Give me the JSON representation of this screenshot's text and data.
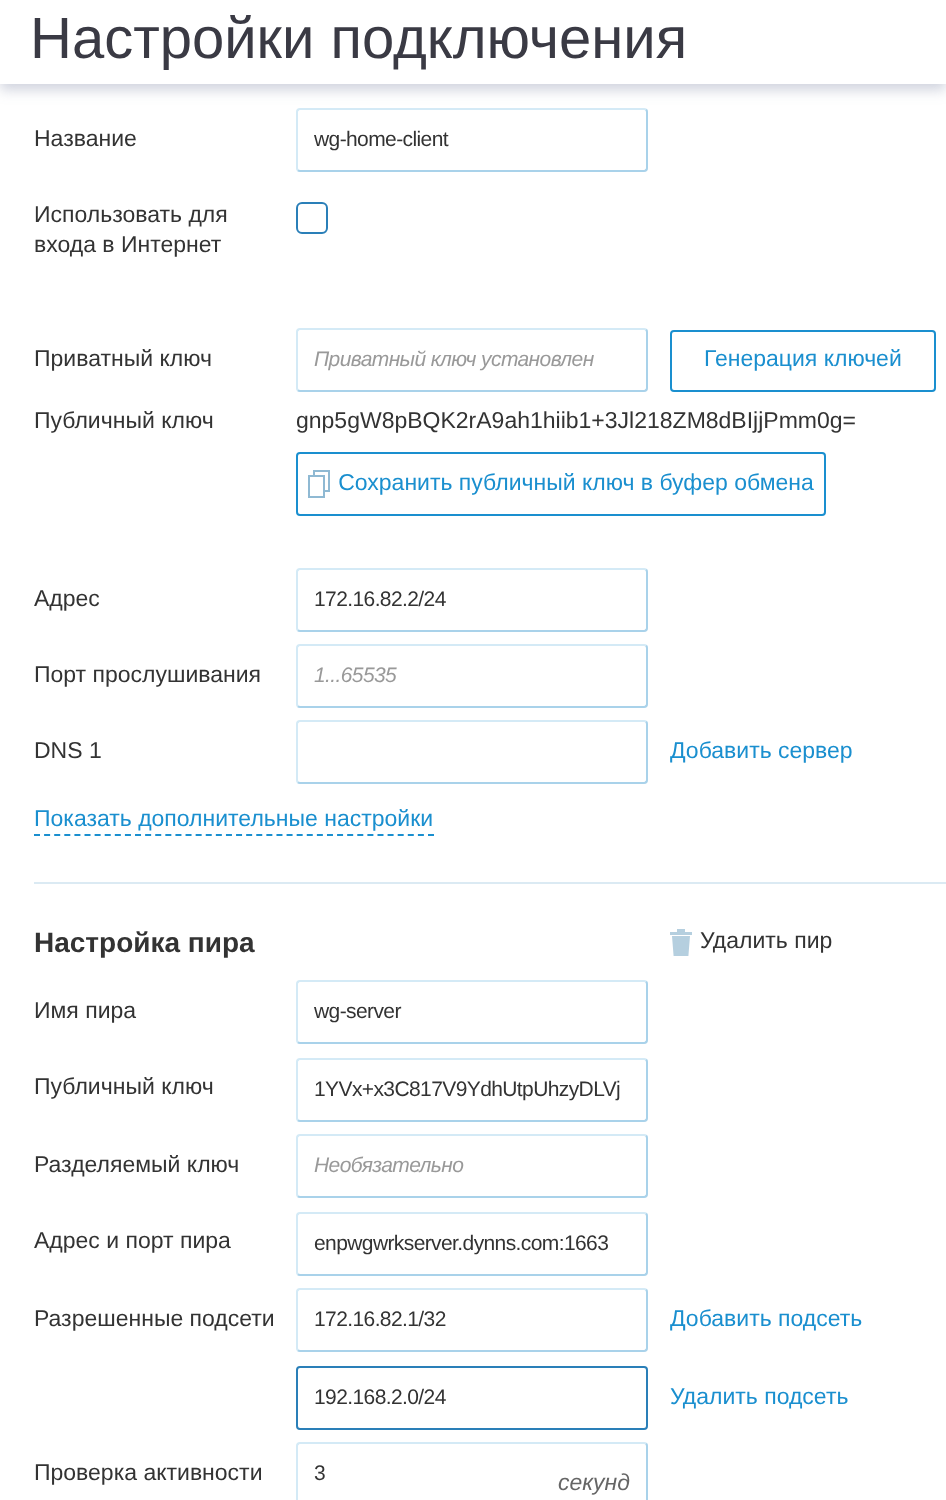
{
  "title": "Настройки подключения",
  "connection": {
    "groups": [
      [
        {
          "kind": "input",
          "label": "Название",
          "value": "wg-home-client",
          "focused": false
        },
        {
          "kind": "checkbox",
          "label": "Использовать для входа в Интернет",
          "checked": false
        }
      ],
      [
        {
          "kind": "input",
          "label": "Приватный ключ",
          "placeholder": "Приватный ключ установлен",
          "focused": false,
          "button": "Генерация ключей"
        },
        {
          "kind": "text",
          "label": "Публичный ключ",
          "value": "gnp5gW8pBQK2rA9ah1hiib1+3Jl218ZM8dBIjjPmm0g="
        },
        {
          "kind": "button",
          "label": "Сохранить публичный ключ в буфер обмена"
        }
      ],
      [
        {
          "kind": "input",
          "label": "Адрес",
          "value": "172.16.82.2/24",
          "focused": false
        },
        {
          "kind": "input",
          "label": "Порт прослушивания",
          "placeholder": "1...65535",
          "focused": false
        },
        {
          "kind": "input",
          "label": "DNS 1",
          "focused": false,
          "link": "Добавить сервер"
        }
      ]
    ],
    "advanced_link": "Показать дополнительные настройки"
  },
  "peer": {
    "title": "Настройка пира",
    "delete": "Удалить пир",
    "rows": [
      {
        "kind": "input",
        "label": "Имя пира",
        "value": "wg-server",
        "focused": false
      },
      {
        "kind": "input",
        "label": "Публичный ключ",
        "value": "1YVx+x3C817V9YdhUtpUhzyDLVj",
        "focused": false
      },
      {
        "kind": "input",
        "label": "Разделяемый ключ",
        "placeholder": "Необязательно",
        "focused": false
      },
      {
        "kind": "input",
        "label": "Адрес и порт пира",
        "value": "enpwgwrkserver.dynns.com:1663",
        "focused": false
      },
      {
        "kind": "input",
        "label": "Разрешенные подсети",
        "value": "172.16.82.1/32",
        "focused": false,
        "link": "Добавить подсеть"
      },
      {
        "kind": "input",
        "value": "192.168.2.0/24",
        "focused": true,
        "link": "Удалить подсеть"
      },
      {
        "kind": "input",
        "label": "Проверка активности",
        "value": "3",
        "unit": "секунд",
        "focused": false
      }
    ]
  }
}
